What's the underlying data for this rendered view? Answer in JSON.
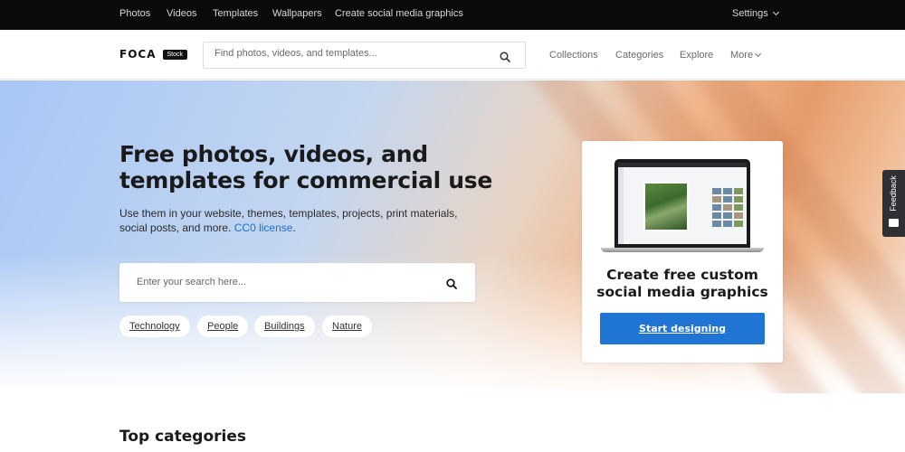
{
  "topnav": {
    "items": [
      "Photos",
      "Videos",
      "Templates",
      "Wallpapers",
      "Create social media graphics"
    ],
    "settings_label": "Settings"
  },
  "header": {
    "logo_text": "FOCA",
    "logo_badge": "Stock",
    "search_placeholder": "Find photos, videos, and templates...",
    "nav": [
      "Collections",
      "Categories",
      "Explore"
    ],
    "more_label": "More"
  },
  "hero": {
    "title": "Free photos, videos, and templates for commercial use",
    "subtitle": "Use them in your website, themes, templates, projects, print materials, social posts, and more.",
    "license_link": "CC0 license",
    "license_suffix": ".",
    "search_placeholder": "Enter your search here...",
    "tags": [
      "Technology",
      "People",
      "Buildings",
      "Nature"
    ]
  },
  "promo_card": {
    "title": "Create free custom social media graphics",
    "button_label": "Start designing"
  },
  "feedback_tab": {
    "label": "Feedback"
  },
  "sections": {
    "top_categories_title": "Top categories"
  },
  "colors": {
    "accent": "#1f74d4",
    "link": "#1c6fd1",
    "topbar_bg": "#0a0a0a"
  }
}
